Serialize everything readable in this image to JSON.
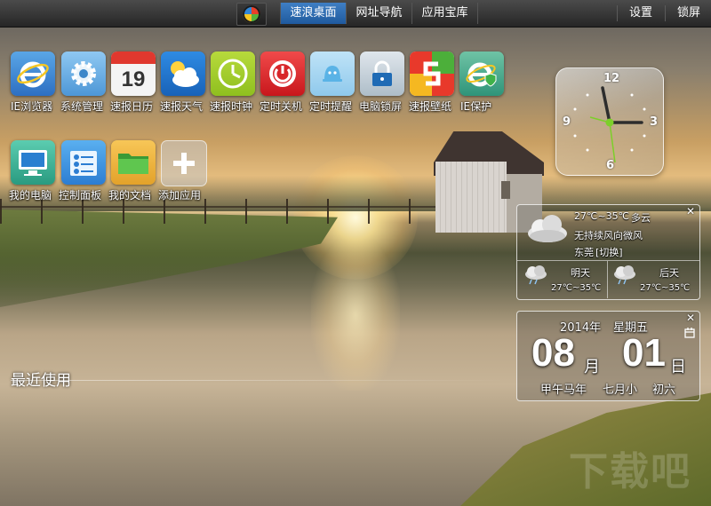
{
  "topbar": {
    "start_icon": "windows-logo-icon",
    "tabs": [
      {
        "label": "速浪桌面",
        "active": true
      },
      {
        "label": "网址导航",
        "active": false
      },
      {
        "label": "应用宝库",
        "active": false
      }
    ],
    "settings_label": "设置",
    "lock_label": "锁屏"
  },
  "apps_row1": [
    {
      "label": "IE浏览器",
      "icon": "ie-browser-icon"
    },
    {
      "label": "系统管理",
      "icon": "gear-icon"
    },
    {
      "label": "速报日历",
      "icon": "calendar-icon",
      "icon_text": "19"
    },
    {
      "label": "速报天气",
      "icon": "weather-icon"
    },
    {
      "label": "速报时钟",
      "icon": "clock-icon"
    },
    {
      "label": "定时关机",
      "icon": "power-icon"
    },
    {
      "label": "定时提醒",
      "icon": "bell-icon"
    },
    {
      "label": "电脑锁屏",
      "icon": "lock-icon"
    },
    {
      "label": "速报壁纸",
      "icon": "wallpaper-icon"
    },
    {
      "label": "IE保护",
      "icon": "ie-shield-icon"
    }
  ],
  "apps_row2": [
    {
      "label": "我的电脑",
      "icon": "computer-icon"
    },
    {
      "label": "控制面板",
      "icon": "control-panel-icon"
    },
    {
      "label": "我的文档",
      "icon": "folder-icon"
    },
    {
      "label": "添加应用",
      "icon": "add-icon"
    }
  ],
  "clock": {
    "numbers": [
      "12",
      "3",
      "6",
      "9"
    ]
  },
  "weather": {
    "today_temp": "27℃~35℃",
    "today_cond": "多云",
    "wind": "无持续风向微风",
    "city": "东莞",
    "switch_label": "[切换]",
    "tomorrow_label": "明天",
    "tomorrow_temp": "27℃~35℃",
    "dayafter_label": "后天",
    "dayafter_temp": "27℃~35℃",
    "close": "✕"
  },
  "calendar": {
    "year": "2014年",
    "weekday": "星期五",
    "month_num": "08",
    "month_unit": "月",
    "day_num": "01",
    "day_unit": "日",
    "lunar_year": "甲午马年",
    "lunar_month": "七月小",
    "lunar_day": "初六",
    "close": "✕"
  },
  "recent_label": "最近使用",
  "watermark": "下载吧"
}
